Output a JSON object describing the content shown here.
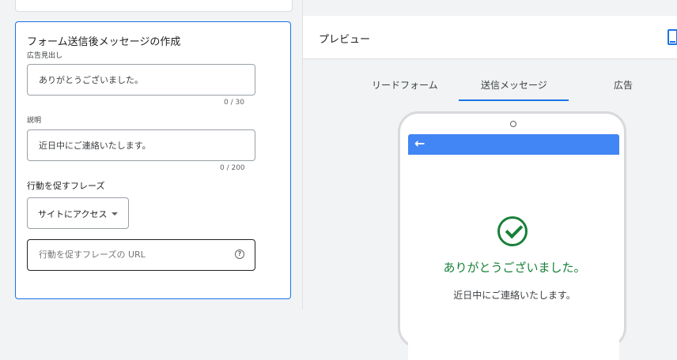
{
  "form": {
    "title": "フォーム送信後メッセージの作成",
    "headline": {
      "label": "広告見出し",
      "value": "ありがとうございました。",
      "counter": "0 / 30"
    },
    "description": {
      "label": "説明",
      "value": "近日中にご連絡いたします。",
      "counter": "0 / 200"
    },
    "cta": {
      "label": "行動を促すフレーズ",
      "selected": "サイトにアクセス"
    },
    "cta_url": {
      "placeholder": "行動を促すフレーズの URL",
      "help_icon": "help-circle-icon"
    }
  },
  "preview": {
    "title": "プレビュー",
    "device_icon": "phone-icon",
    "tabs": [
      {
        "label": "リードフォーム",
        "active": false
      },
      {
        "label": "送信メッセージ",
        "active": true
      },
      {
        "label": "広告",
        "active": false
      }
    ],
    "phone": {
      "back_icon": "arrow-back-icon",
      "check_icon": "check-circle-icon",
      "headline": "ありがとうございました。",
      "description": "近日中にご連絡いたします。"
    }
  },
  "colors": {
    "accent": "#1a73e8",
    "success": "#188038",
    "appbar": "#4285f4"
  }
}
